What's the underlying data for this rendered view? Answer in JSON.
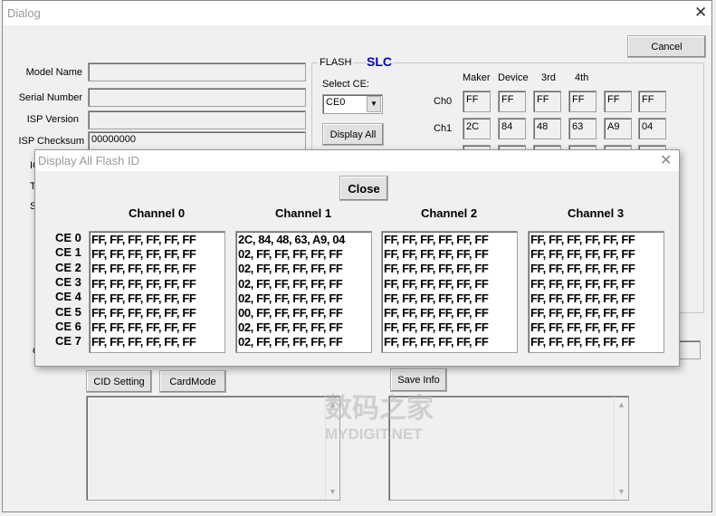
{
  "main": {
    "title": "Dialog",
    "cancel": "Cancel",
    "labels": {
      "model_name": "Model Name",
      "serial_number": "Serial Number",
      "isp_version": "ISP Version",
      "isp_checksum": "ISP Checksum"
    },
    "values": {
      "model_name": "",
      "serial_number": "",
      "isp_version": "",
      "isp_checksum": "00000000"
    },
    "hidden_labels": [
      "IC",
      "To",
      "S",
      "C"
    ],
    "flash": {
      "group": "FLASH",
      "type": "SLC",
      "select_ce_label": "Select CE:",
      "select_ce_value": "CE0",
      "display_all": "Display All",
      "headers": [
        "Maker",
        "Device",
        "3rd",
        "4th"
      ],
      "rows": [
        {
          "label": "Ch0",
          "values": [
            "FF",
            "FF",
            "FF",
            "FF",
            "FF",
            "FF"
          ]
        },
        {
          "label": "Ch1",
          "values": [
            "2C",
            "84",
            "48",
            "63",
            "A9",
            "04"
          ]
        }
      ]
    },
    "buttons": {
      "cid_setting": "CID Setting",
      "card_mode": "CardMode",
      "save_info": "Save Info"
    },
    "watermark": {
      "cn": "数码之家",
      "en": "MYDIGIT.NET"
    }
  },
  "popup": {
    "title": "Display All Flash ID",
    "close": "Close",
    "ce_labels": [
      "CE 0",
      "CE 1",
      "CE 2",
      "CE 3",
      "CE 4",
      "CE 5",
      "CE 6",
      "CE 7"
    ],
    "channels": [
      {
        "name": "Channel 0",
        "text": "FF, FF, FF, FF, FF, FF\nFF, FF, FF, FF, FF, FF\nFF, FF, FF, FF, FF, FF\nFF, FF, FF, FF, FF, FF\nFF, FF, FF, FF, FF, FF\nFF, FF, FF, FF, FF, FF\nFF, FF, FF, FF, FF, FF\nFF, FF, FF, FF, FF, FF"
      },
      {
        "name": "Channel 1",
        "text": "2C, 84, 48, 63, A9, 04\n02, FF, FF, FF, FF, FF\n02, FF, FF, FF, FF, FF\n02, FF, FF, FF, FF, FF\n02, FF, FF, FF, FF, FF\n00, FF, FF, FF, FF, FF\n02, FF, FF, FF, FF, FF\n02, FF, FF, FF, FF, FF"
      },
      {
        "name": "Channel 2",
        "text": "FF, FF, FF, FF, FF, FF\nFF, FF, FF, FF, FF, FF\nFF, FF, FF, FF, FF, FF\nFF, FF, FF, FF, FF, FF\nFF, FF, FF, FF, FF, FF\nFF, FF, FF, FF, FF, FF\nFF, FF, FF, FF, FF, FF\nFF, FF, FF, FF, FF, FF"
      },
      {
        "name": "Channel 3",
        "text": "FF, FF, FF, FF, FF, FF\nFF, FF, FF, FF, FF, FF\nFF, FF, FF, FF, FF, FF\nFF, FF, FF, FF, FF, FF\nFF, FF, FF, FF, FF, FF\nFF, FF, FF, FF, FF, FF\nFF, FF, FF, FF, FF, FF\nFF, FF, FF, FF, FF, FF"
      }
    ]
  },
  "colors": {
    "slc": "#0000c8",
    "titlebar": "#ffffff",
    "dialog_bg": "#f0f0f0"
  }
}
